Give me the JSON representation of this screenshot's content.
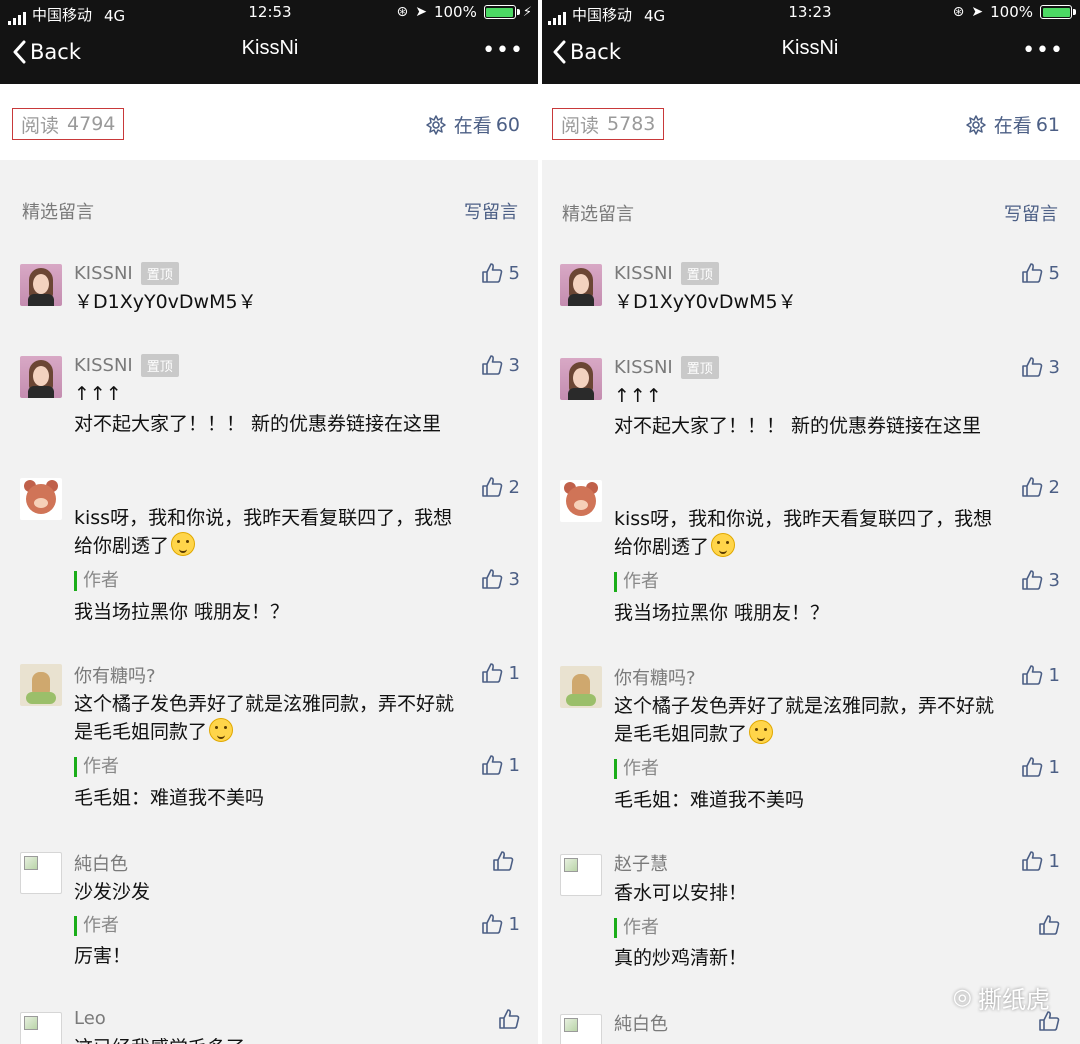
{
  "left": {
    "status": {
      "carrier": "中国移动",
      "network": "4G",
      "time": "12:53",
      "battery": "100%"
    },
    "nav": {
      "back": "Back",
      "title": "KissNi",
      "more": "•••"
    },
    "read": {
      "label": "阅读",
      "count": "4794"
    },
    "watching": {
      "label": "在看",
      "count": "60"
    },
    "section": {
      "title": "精选留言",
      "write": "写留言"
    },
    "comments": [
      {
        "name": "KISSNI",
        "pin": "置顶",
        "likes": "5",
        "text": "￥D1XyY0vDwM5￥"
      },
      {
        "name": "KISSNI",
        "pin": "置顶",
        "likes": "3",
        "text1": "↑↑↑",
        "text2": "对不起大家了！！！ 新的优惠券链接在这里"
      },
      {
        "likes": "2",
        "text1": "kiss呀，我和你说，我昨天看复联四了，我想",
        "text2": "给你剧透了",
        "author": "作者",
        "author_likes": "3",
        "reply": "我当场拉黑你 哦朋友！？"
      },
      {
        "name": "你有糖吗?",
        "likes": "1",
        "text1": "这个橘子发色弄好了就是泫雅同款，弄不好就",
        "text2": "是毛毛姐同款了",
        "author": "作者",
        "author_likes": "1",
        "reply": "毛毛姐：难道我不美吗"
      },
      {
        "name": "純白色",
        "likes": "",
        "text": "沙发沙发",
        "author": "作者",
        "author_likes": "1",
        "reply": "厉害！"
      },
      {
        "name": "Leo",
        "likes": "",
        "text": "这已经我感觉毛多了"
      }
    ]
  },
  "right": {
    "status": {
      "carrier": "中国移动",
      "network": "4G",
      "time": "13:23",
      "battery": "100%"
    },
    "nav": {
      "back": "Back",
      "title": "KissNi",
      "more": "•••"
    },
    "read": {
      "label": "阅读",
      "count": "5783"
    },
    "watching": {
      "label": "在看",
      "count": "61"
    },
    "section": {
      "title": "精选留言",
      "write": "写留言"
    },
    "comments": [
      {
        "name": "KISSNI",
        "pin": "置顶",
        "likes": "5",
        "text": "￥D1XyY0vDwM5￥"
      },
      {
        "name": "KISSNI",
        "pin": "置顶",
        "likes": "3",
        "text1": "↑↑↑",
        "text2": "对不起大家了！！！ 新的优惠券链接在这里"
      },
      {
        "likes": "2",
        "text1": "kiss呀，我和你说，我昨天看复联四了，我想",
        "text2": "给你剧透了",
        "author": "作者",
        "author_likes": "3",
        "reply": "我当场拉黑你 哦朋友！？"
      },
      {
        "name": "你有糖吗?",
        "likes": "1",
        "text1": "这个橘子发色弄好了就是泫雅同款，弄不好就",
        "text2": "是毛毛姐同款了",
        "author": "作者",
        "author_likes": "1",
        "reply": "毛毛姐：难道我不美吗"
      },
      {
        "name": "赵子慧",
        "likes": "1",
        "text": "香水可以安排！",
        "author": "作者",
        "author_likes": "",
        "reply": "真的炒鸡清新！"
      },
      {
        "name": "純白色",
        "likes": ""
      }
    ],
    "watermark": "撕纸虎"
  }
}
